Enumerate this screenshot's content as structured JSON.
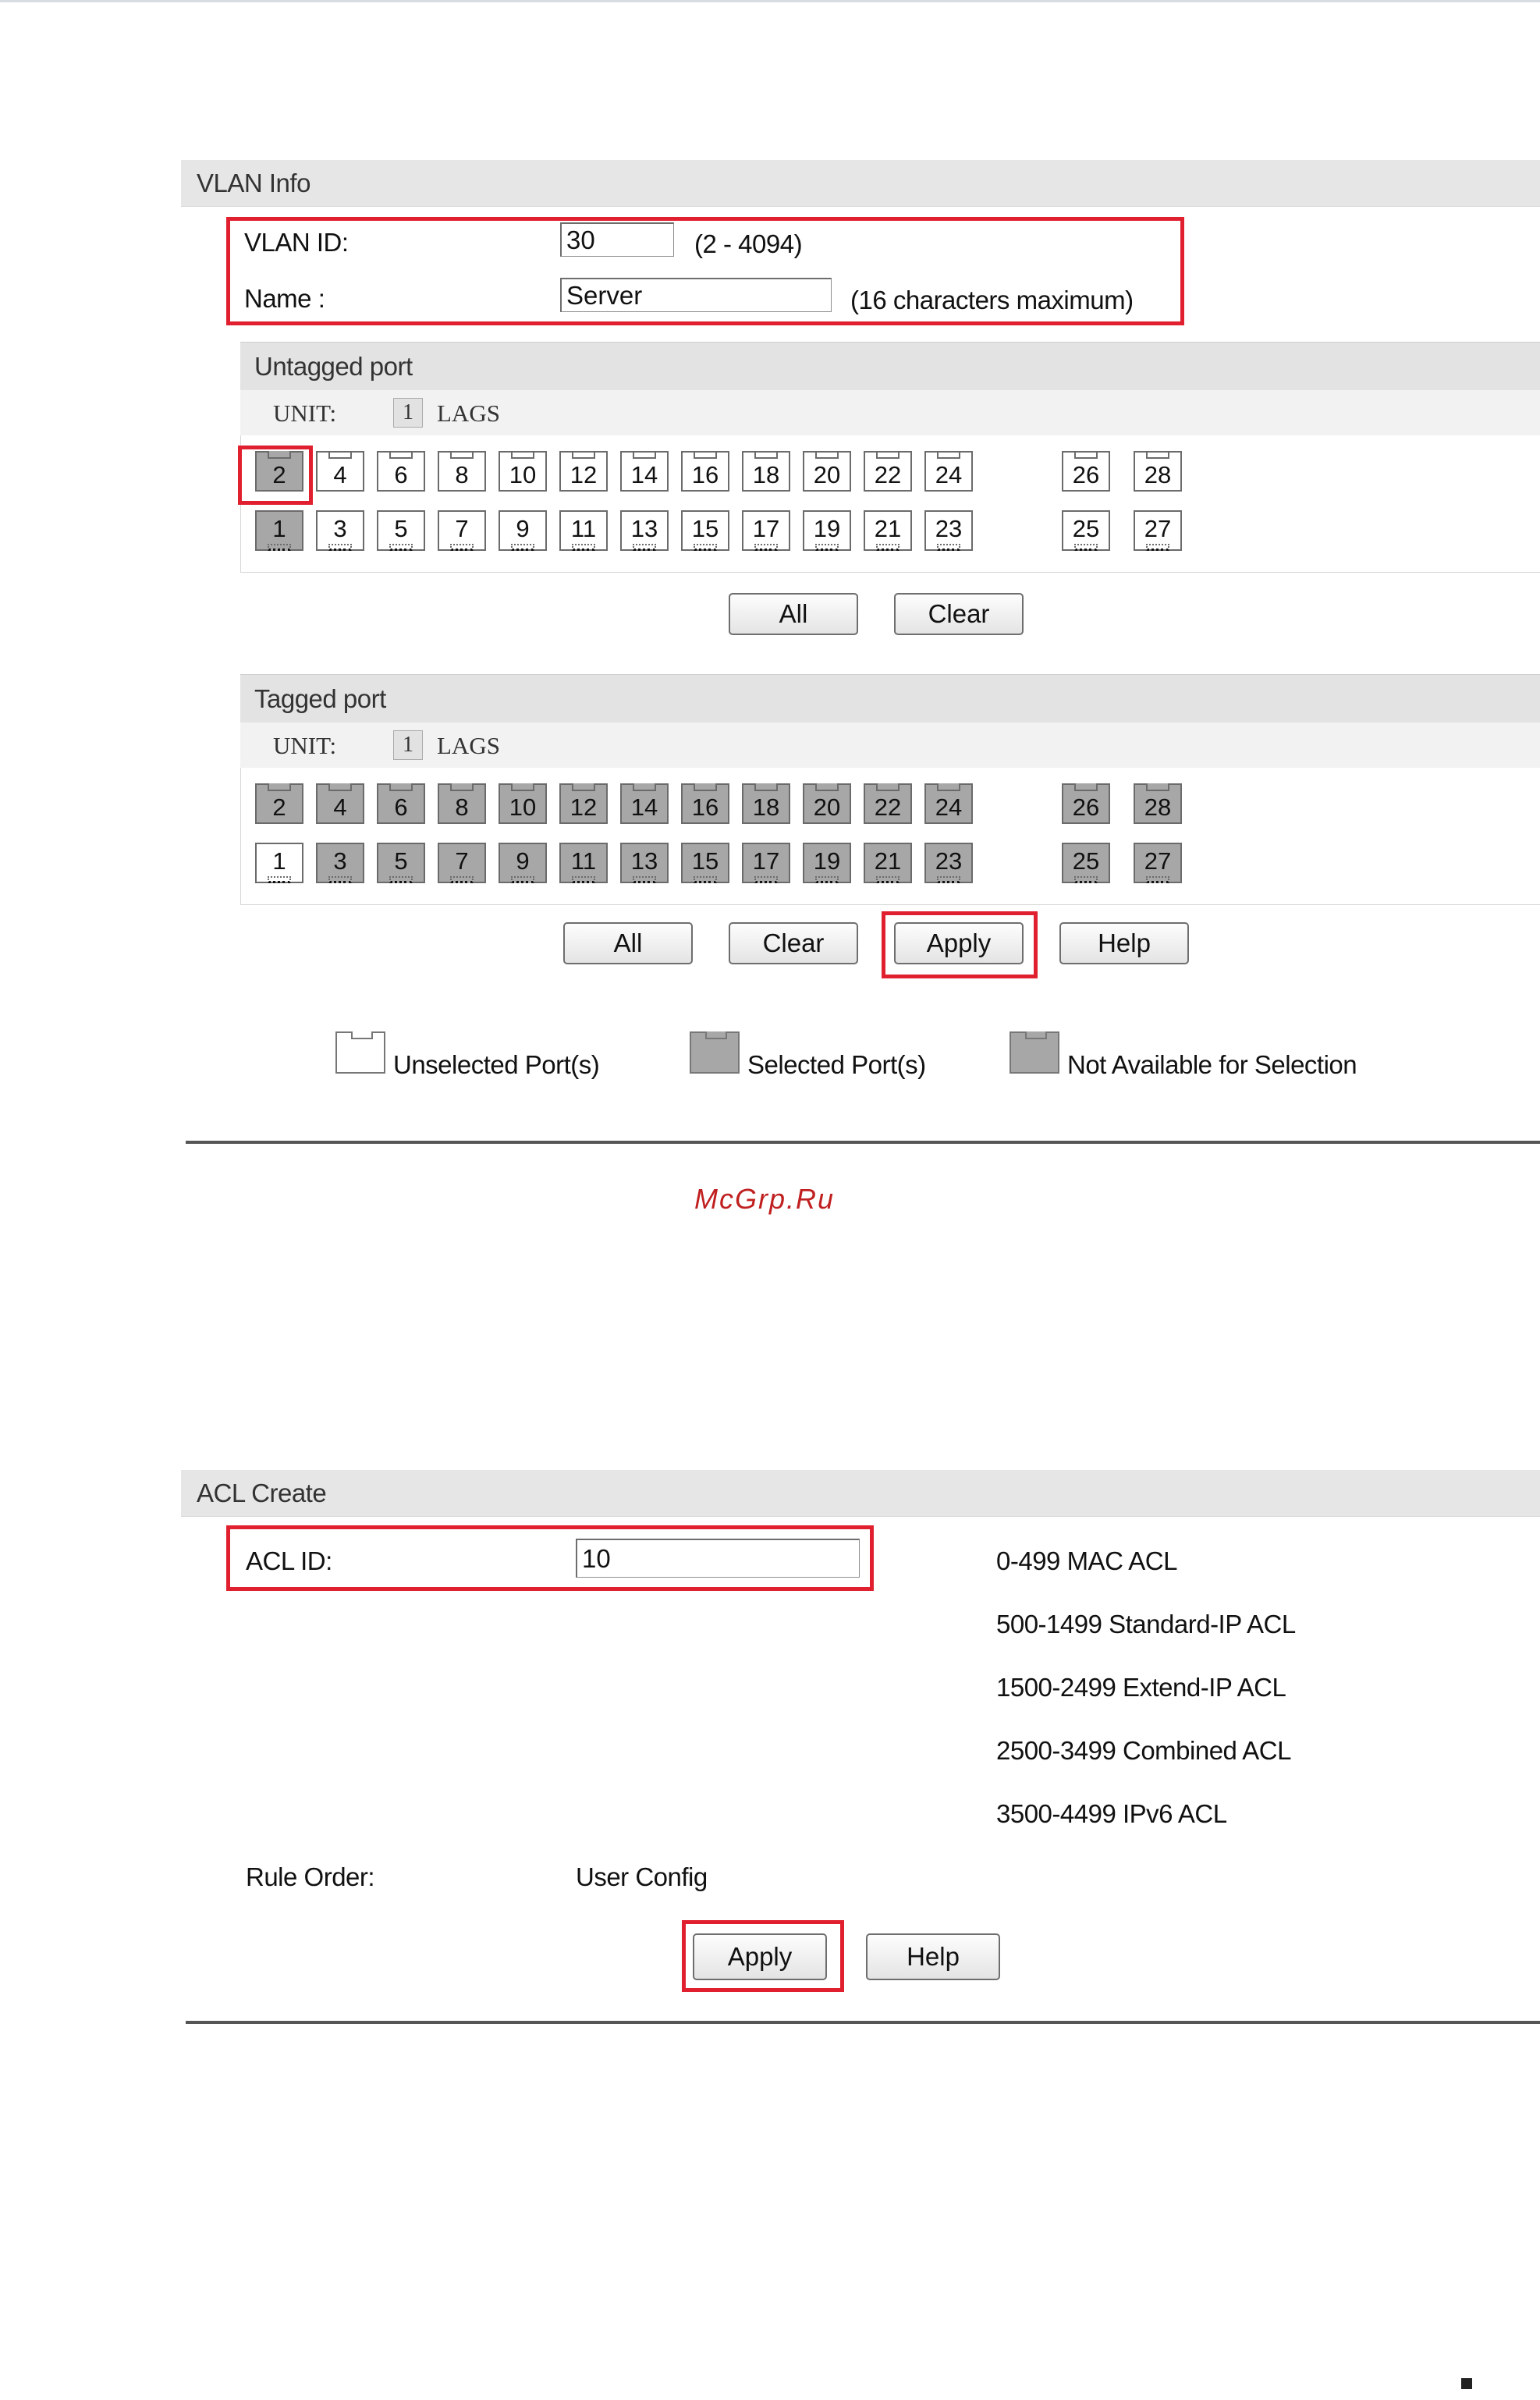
{
  "vlan": {
    "section_title": "VLAN Info",
    "vlan_id_label": "VLAN ID:",
    "vlan_id_value": "30",
    "vlan_id_hint": "(2 - 4094)",
    "name_label": "Name :",
    "name_value": "Server",
    "name_hint": "(16 characters maximum)",
    "untagged": {
      "title": "Untagged port",
      "unit_label": "UNIT:",
      "unit_value": "1",
      "lags_label": "LAGS",
      "top_row": [
        "2",
        "4",
        "6",
        "8",
        "10",
        "12",
        "14",
        "16",
        "18",
        "20",
        "22",
        "24",
        "26",
        "28"
      ],
      "bottom_row": [
        "1",
        "3",
        "5",
        "7",
        "9",
        "11",
        "13",
        "15",
        "17",
        "19",
        "21",
        "23",
        "25",
        "27"
      ],
      "selected_ports": [
        "2",
        "1"
      ],
      "all_label": "All",
      "clear_label": "Clear"
    },
    "tagged": {
      "title": "Tagged port",
      "unit_label": "UNIT:",
      "unit_value": "1",
      "lags_label": "LAGS",
      "top_row": [
        "2",
        "4",
        "6",
        "8",
        "10",
        "12",
        "14",
        "16",
        "18",
        "20",
        "22",
        "24",
        "26",
        "28"
      ],
      "bottom_row": [
        "1",
        "3",
        "5",
        "7",
        "9",
        "11",
        "13",
        "15",
        "17",
        "19",
        "21",
        "23",
        "25",
        "27"
      ],
      "unselected_ports": [
        "1"
      ],
      "all_label": "All",
      "clear_label": "Clear",
      "apply_label": "Apply",
      "help_label": "Help"
    },
    "legend": {
      "unselected": "Unselected Port(s)",
      "selected": "Selected Port(s)",
      "not_available": "Not Available for Selection"
    }
  },
  "watermark": "McGrp.Ru",
  "acl": {
    "section_title": "ACL Create",
    "acl_id_label": "ACL ID:",
    "acl_id_value": "10",
    "ranges": [
      "0-499 MAC ACL",
      "500-1499 Standard-IP ACL",
      "1500-2499 Extend-IP ACL",
      "2500-3499 Combined ACL",
      "3500-4499 IPv6 ACL"
    ],
    "rule_order_label": "Rule Order:",
    "rule_order_value": "User Config",
    "apply_label": "Apply",
    "help_label": "Help"
  },
  "colors": {
    "highlight": "#e0202e",
    "selected_port": "#a7a7a7",
    "header_bg": "#e6e6e6",
    "watermark": "#c02020"
  }
}
